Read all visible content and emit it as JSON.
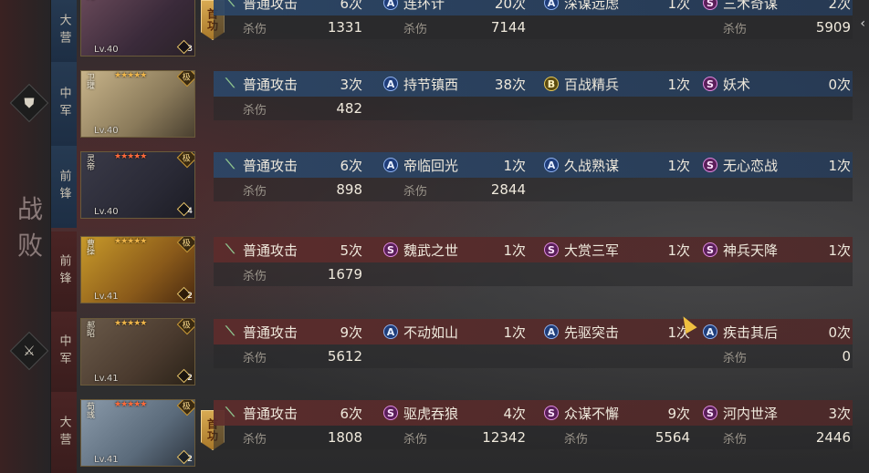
{
  "result_label": "战败",
  "team_icons": [
    {
      "icon": "shield-icon",
      "glyph": "⛊"
    },
    {
      "icon": "sword-icon",
      "glyph": "⚔"
    }
  ],
  "merit_label": "首功",
  "generals": [
    {
      "team": "blue",
      "position": "大营",
      "name": "元",
      "level": "Lv.40",
      "stars": "",
      "star_color": "gold",
      "badge": "",
      "corner_count": "3",
      "merit": true,
      "normal_attack": {
        "label": "普通攻击",
        "count": "6次",
        "damage_label": "杀伤",
        "damage": "1331"
      },
      "skills": [
        {
          "type": "A",
          "name": "连环计",
          "count": "20次",
          "damage_label": "杀伤",
          "damage": "7144"
        },
        {
          "type": "A",
          "name": "深谋远虑",
          "count": "1次",
          "damage_label": "",
          "damage": ""
        },
        {
          "type": "S",
          "name": "三术奇谋",
          "count": "2次",
          "damage_label": "杀伤",
          "damage": "5909"
        }
      ]
    },
    {
      "team": "blue",
      "position": "中军",
      "name": "卫瓘",
      "level": "Lv.40",
      "stars": "★★★★★",
      "star_color": "gold",
      "badge": "极",
      "corner_count": "",
      "merit": false,
      "normal_attack": {
        "label": "普通攻击",
        "count": "3次",
        "damage_label": "杀伤",
        "damage": "482"
      },
      "skills": [
        {
          "type": "A",
          "name": "持节镇西",
          "count": "38次",
          "damage_label": "",
          "damage": ""
        },
        {
          "type": "B",
          "name": "百战精兵",
          "count": "1次",
          "damage_label": "",
          "damage": ""
        },
        {
          "type": "S",
          "name": "妖术",
          "count": "0次",
          "damage_label": "",
          "damage": ""
        }
      ]
    },
    {
      "team": "blue",
      "position": "前锋",
      "name": "灵帝",
      "level": "Lv.40",
      "stars": "★★★★★",
      "star_color": "red",
      "badge": "极",
      "corner_count": "4",
      "merit": false,
      "normal_attack": {
        "label": "普通攻击",
        "count": "6次",
        "damage_label": "杀伤",
        "damage": "898"
      },
      "skills": [
        {
          "type": "A",
          "name": "帝临回光",
          "count": "1次",
          "damage_label": "杀伤",
          "damage": "2844"
        },
        {
          "type": "A",
          "name": "久战熟谋",
          "count": "1次",
          "damage_label": "",
          "damage": ""
        },
        {
          "type": "S",
          "name": "无心恋战",
          "count": "1次",
          "damage_label": "",
          "damage": ""
        }
      ]
    },
    {
      "team": "red",
      "position": "前锋",
      "name": "曹操",
      "level": "Lv.41",
      "stars": "★★★★★",
      "star_color": "gold",
      "badge": "极",
      "corner_count": "2",
      "merit": false,
      "normal_attack": {
        "label": "普通攻击",
        "count": "5次",
        "damage_label": "杀伤",
        "damage": "1679"
      },
      "skills": [
        {
          "type": "S",
          "name": "魏武之世",
          "count": "1次",
          "damage_label": "",
          "damage": ""
        },
        {
          "type": "S",
          "name": "大赏三军",
          "count": "1次",
          "damage_label": "",
          "damage": ""
        },
        {
          "type": "S",
          "name": "神兵天降",
          "count": "1次",
          "damage_label": "",
          "damage": ""
        }
      ]
    },
    {
      "team": "red",
      "position": "中军",
      "name": "郝昭",
      "level": "Lv.41",
      "stars": "★★★★★",
      "star_color": "gold",
      "badge": "极",
      "corner_count": "2",
      "merit": false,
      "normal_attack": {
        "label": "普通攻击",
        "count": "9次",
        "damage_label": "杀伤",
        "damage": "5612"
      },
      "skills": [
        {
          "type": "A",
          "name": "不动如山",
          "count": "1次",
          "damage_label": "",
          "damage": ""
        },
        {
          "type": "A",
          "name": "先驱突击",
          "count": "1次",
          "damage_label": "",
          "damage": ""
        },
        {
          "type": "A",
          "name": "疾击其后",
          "count": "0次",
          "damage_label": "杀伤",
          "damage": "0"
        }
      ]
    },
    {
      "team": "red",
      "position": "大营",
      "name": "荀彧",
      "level": "Lv.41",
      "stars": "★★★★★",
      "star_color": "red",
      "badge": "极",
      "corner_count": "2",
      "merit": true,
      "normal_attack": {
        "label": "普通攻击",
        "count": "6次",
        "damage_label": "杀伤",
        "damage": "1808"
      },
      "skills": [
        {
          "type": "S",
          "name": "驱虎吞狼",
          "count": "4次",
          "damage_label": "杀伤",
          "damage": "12342"
        },
        {
          "type": "S",
          "name": "众谋不懈",
          "count": "9次",
          "damage_label": "杀伤",
          "damage": "5564"
        },
        {
          "type": "S",
          "name": "河内世泽",
          "count": "3次",
          "damage_label": "杀伤",
          "damage": "2446"
        }
      ]
    }
  ],
  "colors": {
    "blue_row": "#2c4666",
    "red_row": "#5c2c2c",
    "skill_A": "#1f3d7a",
    "skill_B": "#5a4a10",
    "skill_S": "#5a1f5a"
  }
}
